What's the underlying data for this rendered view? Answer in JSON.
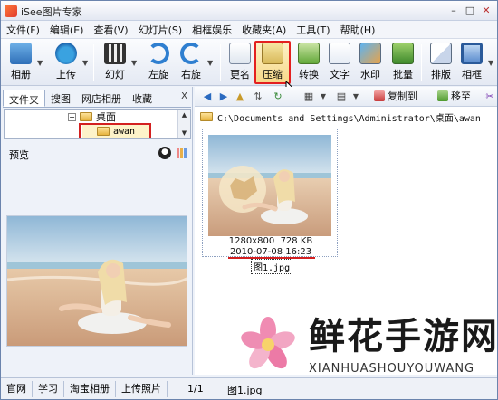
{
  "window": {
    "title": "iSee图片专家"
  },
  "menu": [
    "文件(F)",
    "编辑(E)",
    "查看(V)",
    "幻灯片(S)",
    "相框娱乐",
    "收藏夹(A)",
    "工具(T)",
    "帮助(H)"
  ],
  "toolbar": {
    "album": "相册",
    "upload": "上传",
    "slideshow": "幻灯",
    "rotate_left": "左旋",
    "rotate_right": "右旋",
    "rename": "更名",
    "compress": "压缩",
    "convert": "转换",
    "text": "文字",
    "watermark": "水印",
    "batch": "批量",
    "layout": "排版",
    "frame": "相框"
  },
  "left_pane": {
    "tabs": [
      "文件夹",
      "搜图",
      "网店相册",
      "收藏"
    ],
    "tree": {
      "parent": "桌面",
      "selected": "awan"
    },
    "preview_label": "预览"
  },
  "nav": {
    "copy_to": "复制到",
    "move_to": "移至"
  },
  "path": "C:\\Documents and Settings\\Administrator\\桌面\\awan",
  "thumbnail": {
    "dimensions": "1280x800",
    "size": "728 KB",
    "date": "2010-07-08 16:23",
    "filename": "图1.jpg"
  },
  "status": {
    "tabs": [
      "官网",
      "学习",
      "淘宝相册",
      "上传照片"
    ],
    "page": "1/1",
    "file": "图1.jpg"
  },
  "watermark_overlay": {
    "title": "鲜花手游网",
    "subtitle": "XIANHUASHOUYOUWANG"
  },
  "colors": {
    "highlight_red": "#d32020",
    "selected_button_bg": "#f7d98a",
    "window_border": "#6b84ad"
  }
}
